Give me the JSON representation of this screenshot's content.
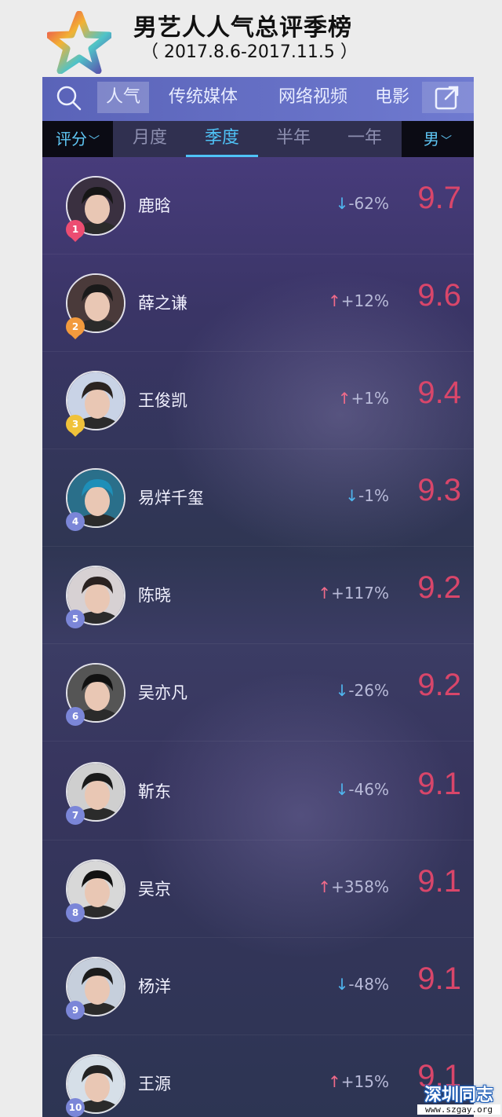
{
  "header": {
    "title": "男艺人人气总评季榜",
    "subtitle": "（ 2017.8.6-2017.11.5 ）"
  },
  "topnav": {
    "tabs": [
      "人气",
      "传统媒体",
      "网络视频",
      "电影"
    ],
    "active_tab": "人气"
  },
  "subnav": {
    "rating_dropdown": "评分",
    "periods": [
      "月度",
      "季度",
      "半年",
      "一年"
    ],
    "active_period": "季度",
    "gender_dropdown": "男"
  },
  "colors": {
    "accent_blue": "#4fc3f7",
    "score_red": "#d9466a",
    "down_arrow": "#4fb6ef",
    "up_arrow": "#f06b8a",
    "rank1": "#ec4d72",
    "rank2": "#f29a3d",
    "rank3": "#f0c23a",
    "rank_other": "#7b86d8"
  },
  "rows": [
    {
      "rank": "1",
      "name": "鹿晗",
      "direction": "down",
      "arrow": "↓",
      "change": "-62%",
      "score": "9.7"
    },
    {
      "rank": "2",
      "name": "薛之谦",
      "direction": "up",
      "arrow": "↑",
      "change": "+12%",
      "score": "9.6"
    },
    {
      "rank": "3",
      "name": "王俊凯",
      "direction": "up",
      "arrow": "↑",
      "change": "+1%",
      "score": "9.4"
    },
    {
      "rank": "4",
      "name": "易烊千玺",
      "direction": "down",
      "arrow": "↓",
      "change": "-1%",
      "score": "9.3"
    },
    {
      "rank": "5",
      "name": "陈晓",
      "direction": "up",
      "arrow": "↑",
      "change": "+117%",
      "score": "9.2"
    },
    {
      "rank": "6",
      "name": "吴亦凡",
      "direction": "down",
      "arrow": "↓",
      "change": "-26%",
      "score": "9.2"
    },
    {
      "rank": "7",
      "name": "靳东",
      "direction": "down",
      "arrow": "↓",
      "change": "-46%",
      "score": "9.1"
    },
    {
      "rank": "8",
      "name": "吴京",
      "direction": "up",
      "arrow": "↑",
      "change": "+358%",
      "score": "9.1"
    },
    {
      "rank": "9",
      "name": "杨洋",
      "direction": "down",
      "arrow": "↓",
      "change": "-48%",
      "score": "9.1"
    },
    {
      "rank": "10",
      "name": "王源",
      "direction": "up",
      "arrow": "↑",
      "change": "+15%",
      "score": "9.1"
    }
  ],
  "watermark": {
    "text": "深圳同志",
    "url": "www.szgay.org"
  }
}
